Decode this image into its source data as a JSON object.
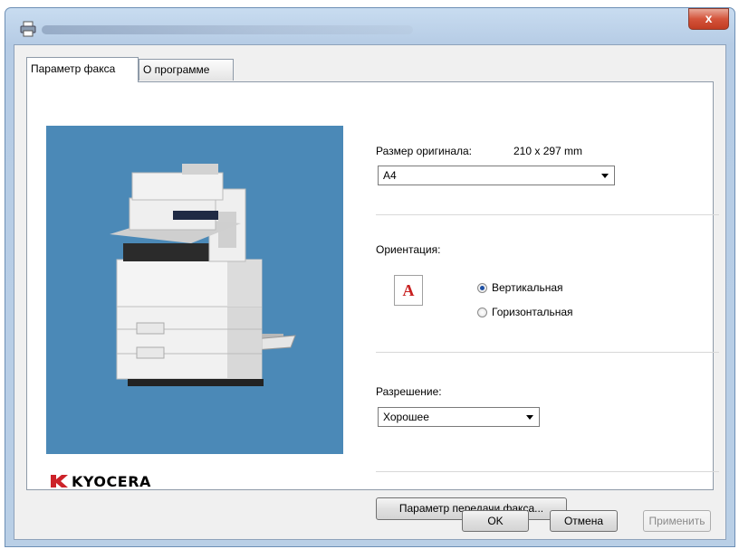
{
  "window": {
    "close_label": "x"
  },
  "tabs": [
    {
      "label": "Параметр факса",
      "active": true
    },
    {
      "label": "О программе",
      "active": false
    }
  ],
  "brand": {
    "logo_text": "KYOCERA",
    "logo_color": "#cc2229"
  },
  "original_size": {
    "label": "Размер оригинала:",
    "dimensions": "210 x 297 mm",
    "selected": "A4"
  },
  "orientation": {
    "label": "Ориентация:",
    "icon_letter": "A",
    "options": [
      {
        "label": "Вертикальная",
        "selected": true
      },
      {
        "label": "Горизонтальная",
        "selected": false
      }
    ]
  },
  "resolution": {
    "label": "Разрешение:",
    "selected": "Хорошее"
  },
  "buttons": {
    "fax_tx_settings": "Параметр передачи факса...",
    "ok": "OK",
    "cancel": "Отмена",
    "apply": "Применить"
  },
  "colors": {
    "preview_background": "#4b89b7",
    "accent_red": "#c82020"
  }
}
